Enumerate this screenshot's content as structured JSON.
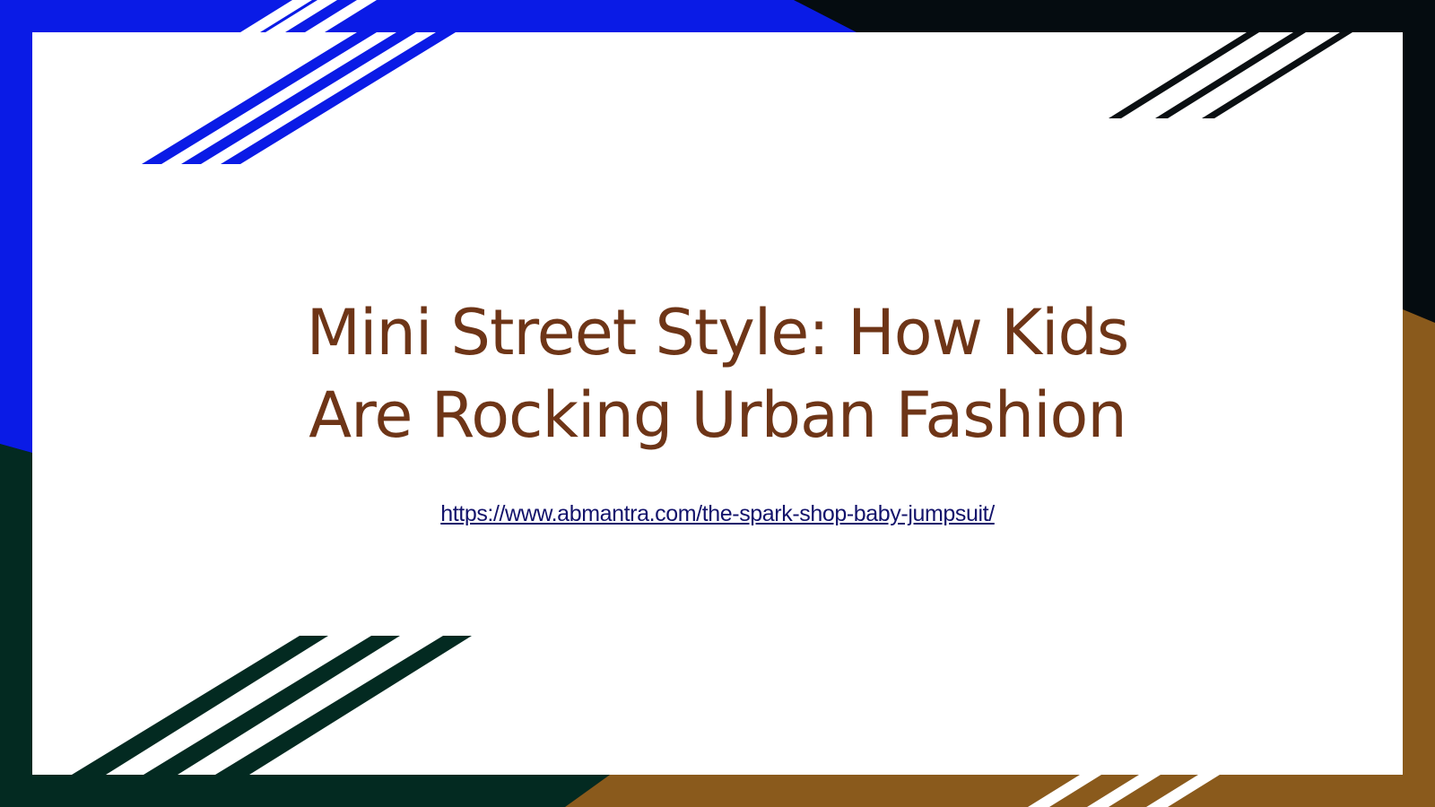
{
  "slide": {
    "title_line1": "Mini Street Style: How Kids",
    "title_line2": "Are Rocking Urban Fashion",
    "link_text": "https://www.abmantra.com/the-spark-shop-baby-jumpsuit/",
    "link_href": "https://www.abmantra.com/the-spark-shop-baby-jumpsuit/"
  },
  "colors": {
    "frame_blue": "#0a1be6",
    "frame_black": "#050c10",
    "frame_dark_green": "#032a21",
    "frame_brown": "#8a5a1c",
    "title": "#6e3517",
    "link": "#13136b",
    "card": "#ffffff"
  }
}
